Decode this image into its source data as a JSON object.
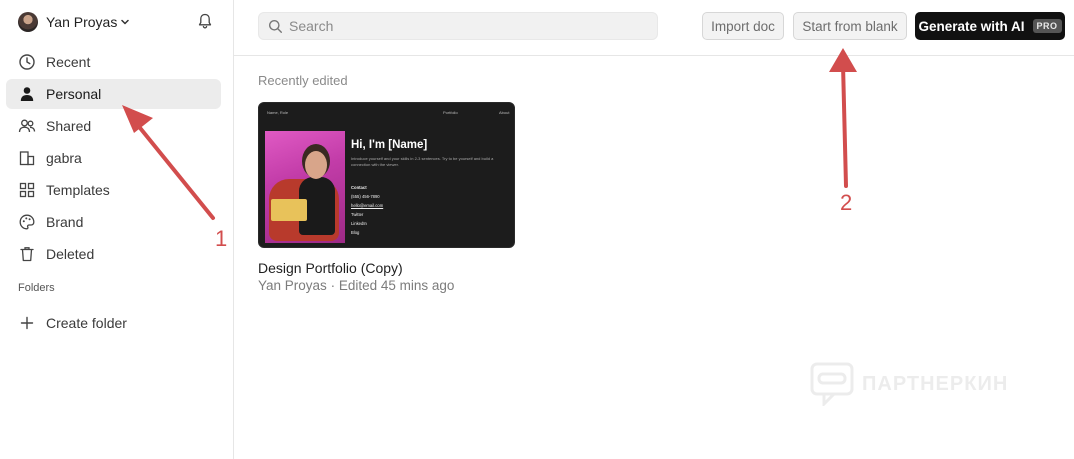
{
  "user": {
    "name": "Yan Proyas"
  },
  "sidebar": {
    "items": [
      {
        "label": "Recent",
        "icon": "clock-icon"
      },
      {
        "label": "Personal",
        "icon": "user-icon",
        "active": true
      },
      {
        "label": "Shared",
        "icon": "users-icon"
      },
      {
        "label": "gabra",
        "icon": "building-icon"
      },
      {
        "label": "Templates",
        "icon": "grid-icon"
      },
      {
        "label": "Brand",
        "icon": "palette-icon"
      },
      {
        "label": "Deleted",
        "icon": "trash-icon"
      }
    ],
    "folders_heading": "Folders",
    "create_folder_label": "Create folder"
  },
  "search": {
    "placeholder": "Search"
  },
  "toolbar": {
    "import_label": "Import doc",
    "blank_label": "Start from blank",
    "ai_label": "Generate with AI",
    "pro_badge": "PRO"
  },
  "main": {
    "section_title": "Recently edited",
    "documents": [
      {
        "title": "Design Portfolio (Copy)",
        "owner": "Yan Proyas",
        "edited": "Edited 45 mins ago",
        "thumbnail": {
          "nav_left": "Name, Role",
          "nav_mid": "Portfolio",
          "nav_right": "About",
          "heading": "Hi, I'm [Name]",
          "intro": "Introduce yourself and your skills in 2-3 sentences. Try to be yourself and build a connection with the viewer.",
          "contact_heading": "Contact",
          "contact_lines": [
            "(555) 456-7890",
            "hello@email.com",
            "Twitter",
            "LinkedIn",
            "Blog"
          ]
        }
      }
    ]
  },
  "annotations": {
    "label_1": "1",
    "label_2": "2"
  },
  "watermark": {
    "text": "ПАРТНЕРКИН"
  },
  "colors": {
    "accent_arrow": "#d24d4d",
    "active_bg": "#ececec",
    "primary_button": "#111111"
  }
}
